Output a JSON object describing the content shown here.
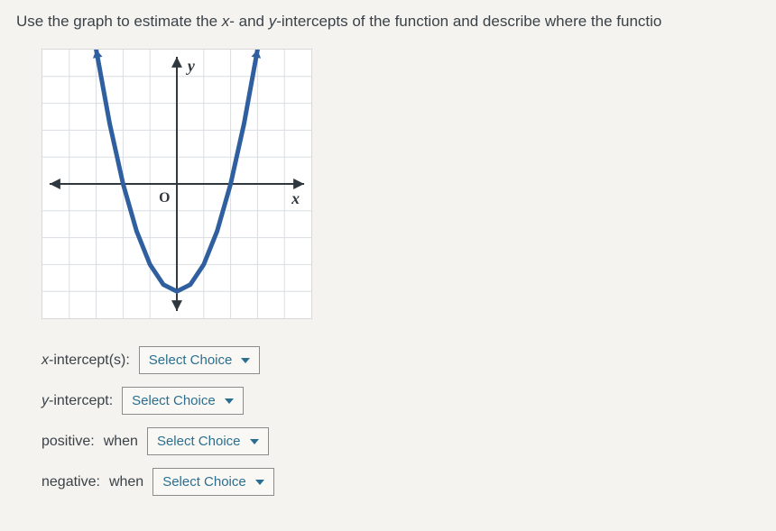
{
  "instruction": {
    "prefix": "Use the graph to estimate the ",
    "x": "x",
    "mid1": "- and ",
    "y": "y",
    "mid2": "-intercepts of the function and describe where the functio"
  },
  "axes": {
    "x_label": "x",
    "y_label": "y",
    "origin": "O"
  },
  "answers": {
    "x_intercepts": {
      "label_prefix": "x",
      "label_suffix": "-intercept(s):",
      "placeholder": "Select Choice"
    },
    "y_intercept": {
      "label_prefix": "y",
      "label_suffix": "-intercept:",
      "placeholder": "Select Choice"
    },
    "positive": {
      "label": "positive:",
      "when": "when",
      "placeholder": "Select Choice"
    },
    "negative": {
      "label": "negative:",
      "when": "when",
      "placeholder": "Select Choice"
    }
  },
  "chart_data": {
    "type": "line",
    "title": "",
    "xlabel": "x",
    "ylabel": "y",
    "xlim": [
      -5,
      5
    ],
    "ylim": [
      -5,
      5
    ],
    "grid": true,
    "x_intercepts": [
      -2,
      2
    ],
    "y_intercept": -4,
    "vertex": [
      0,
      -4
    ],
    "series": [
      {
        "name": "parabola",
        "x": [
          -3,
          -2.5,
          -2,
          -1.5,
          -1,
          -0.5,
          0,
          0.5,
          1,
          1.5,
          2,
          2.5,
          3
        ],
        "values": [
          5,
          2.25,
          0,
          -1.75,
          -3,
          -3.75,
          -4,
          -3.75,
          -3,
          -1.75,
          0,
          2.25,
          5
        ]
      }
    ]
  }
}
